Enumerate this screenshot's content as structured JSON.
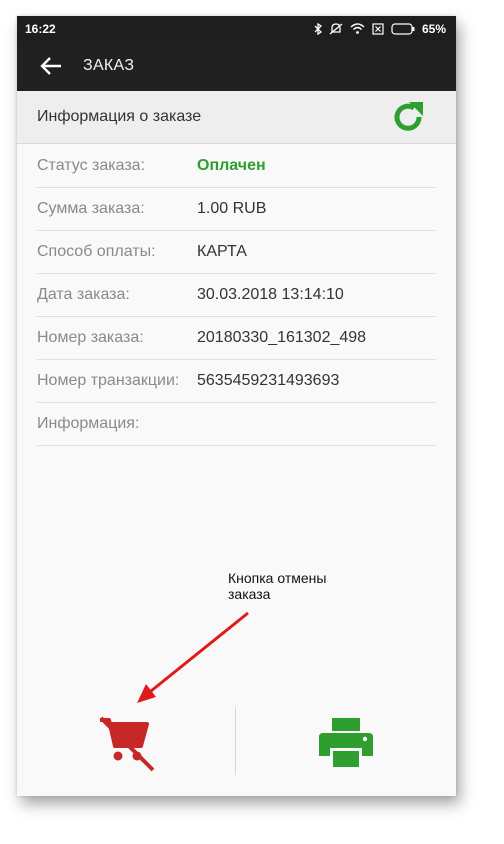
{
  "status_bar": {
    "time": "16:22",
    "battery": "65%",
    "icons": [
      "bluetooth-icon",
      "mute-icon",
      "wifi-icon",
      "sim-icon",
      "battery-icon"
    ]
  },
  "toolbar": {
    "back_icon": "arrow-left-icon",
    "title": "ЗАКАЗ"
  },
  "section": {
    "title": "Информация о заказе",
    "refresh_icon": "refresh-icon"
  },
  "details": [
    {
      "label": "Статус заказа:",
      "value": "Оплачен"
    },
    {
      "label": "Сумма заказа:",
      "value": "1.00 RUB"
    },
    {
      "label": "Способ оплаты:",
      "value": "КАРТА"
    },
    {
      "label": "Дата заказа:",
      "value": "30.03.2018 13:14:10"
    },
    {
      "label": "Номер заказа:",
      "value": "20180330_161302_498"
    },
    {
      "label": "Номер транзакции:",
      "value": "5635459231493693"
    },
    {
      "label": "Информация:",
      "value": ""
    }
  ],
  "annotation": {
    "line1": "Кнопка отмены",
    "line2": "заказа"
  },
  "actions": {
    "cancel_icon": "cart-cancel-icon",
    "print_icon": "printer-icon"
  },
  "colors": {
    "status_paid": "#2e9e2e",
    "cancel": "#c62828",
    "print": "#2e9e2e",
    "toolbar": "#212121",
    "annotation_arrow": "#e01b1b"
  }
}
